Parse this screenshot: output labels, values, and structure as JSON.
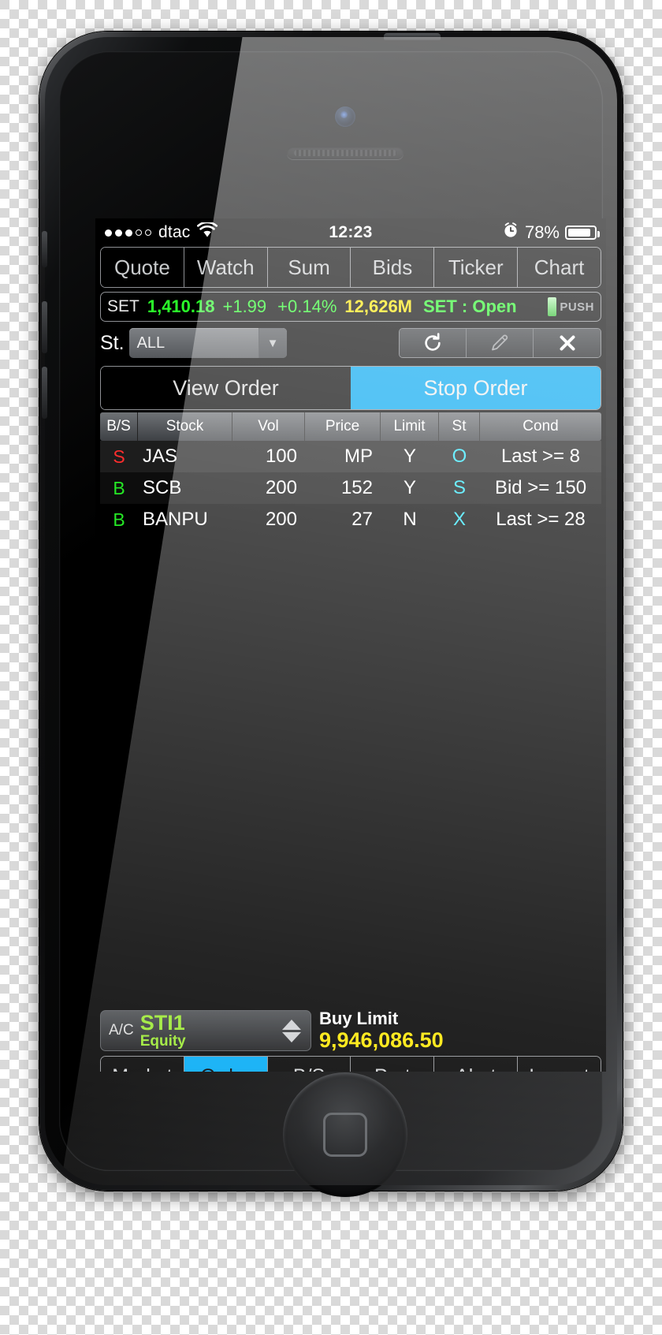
{
  "status_bar": {
    "signal_dots_filled": 3,
    "signal_dots_empty": 2,
    "carrier": "dtac",
    "wifi_icon": "wifi-icon",
    "clock": "12:23",
    "alarm_icon": "alarm-clock-icon",
    "battery_percent": "78%",
    "battery_level": 78
  },
  "top_tabs": [
    {
      "label": "Quote"
    },
    {
      "label": "Watch"
    },
    {
      "label": "Sum"
    },
    {
      "label": "Bids"
    },
    {
      "label": "Ticker"
    },
    {
      "label": "Chart"
    }
  ],
  "market_bar": {
    "name": "SET",
    "index": "1,410.18",
    "change": "+1.99",
    "percent": "+0.14%",
    "volume": "12,626M",
    "status": "SET : Open",
    "push_label": "PUSH",
    "colors": {
      "up": "#2aff2a",
      "volume": "#ffe700"
    }
  },
  "filter_row": {
    "label": "St.",
    "select_value": "ALL",
    "select_options": [
      "ALL"
    ],
    "dropdown_icon": "chevron-down-icon",
    "refresh_icon": "refresh-icon",
    "edit_icon": "pencil-icon",
    "close_icon": "close-x-icon"
  },
  "order_tabs": [
    {
      "label": "View Order",
      "active": false
    },
    {
      "label": "Stop Order",
      "active": true
    }
  ],
  "table": {
    "headers": [
      "B/S",
      "Stock",
      "Vol",
      "Price",
      "Limit",
      "St",
      "Cond"
    ],
    "rows": [
      {
        "bs": "S",
        "bs_side": "sell",
        "stock": "JAS",
        "vol": "100",
        "price": "MP",
        "limit": "Y",
        "st": "O",
        "cond": "Last >= 8"
      },
      {
        "bs": "B",
        "bs_side": "buy",
        "stock": "SCB",
        "vol": "200",
        "price": "152",
        "limit": "Y",
        "st": "S",
        "cond": "Bid >= 150"
      },
      {
        "bs": "B",
        "bs_side": "buy",
        "stock": "BANPU",
        "vol": "200",
        "price": "27",
        "limit": "N",
        "st": "X",
        "cond": "Last >= 28"
      }
    ]
  },
  "account_bar": {
    "ac_label": "A/C",
    "account": "STI1",
    "account_type": "Equity",
    "stepper_up_icon": "triangle-up-icon",
    "stepper_down_icon": "triangle-down-icon",
    "limit_label": "Buy Limit",
    "limit_value": "9,946,086.50"
  },
  "bottom_nav": [
    {
      "label": "Market",
      "active": false
    },
    {
      "label": "Order",
      "active": true
    },
    {
      "label": "B/S",
      "active": false
    },
    {
      "label": "Port",
      "active": false
    },
    {
      "label": "Alert",
      "active": false
    },
    {
      "label": "Logout",
      "active": false
    }
  ]
}
